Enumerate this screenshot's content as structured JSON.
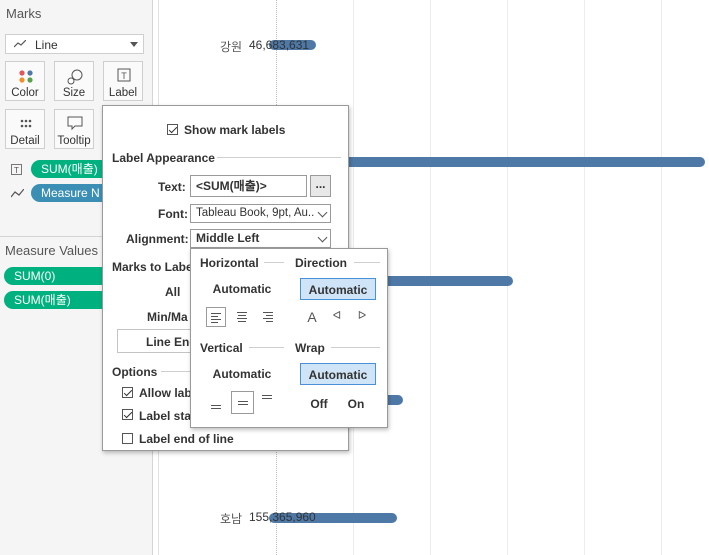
{
  "marks_pane": {
    "title": "Marks",
    "mark_type": "Line",
    "buttons": {
      "color": "Color",
      "size": "Size",
      "label": "Label",
      "detail": "Detail",
      "tooltip": "Tooltip"
    },
    "pills": {
      "label_pill": "SUM(매출)",
      "path_pill": "Measure N"
    }
  },
  "measure_values": {
    "title": "Measure Values",
    "pills": [
      "SUM(0)",
      "SUM(매출)"
    ]
  },
  "chart": {
    "rows": [
      {
        "name": "강원",
        "value_label": "46,683,631",
        "value": 46683631
      },
      {
        "name": "호남",
        "value_label": "155,365,960",
        "value": 155365960
      }
    ],
    "colors": {
      "bar": "#4e79a7",
      "pill_green": "#00b180",
      "pill_blue": "#3b8fb5",
      "selected_option": "#cfe5f7"
    }
  },
  "label_popup": {
    "show_mark_labels": "Show mark labels",
    "label_appearance": "Label Appearance",
    "text_label": "Text:",
    "text_value": "<SUM(매출)>",
    "text_more": "...",
    "font_label": "Font:",
    "font_value": "Tableau Book, 9pt, Au..",
    "alignment_label": "Alignment:",
    "alignment_value": "Middle Left",
    "marks_to_label": "Marks to Labe",
    "all": "All",
    "minmax": "Min/Ma",
    "line_ends": "Line End",
    "options": "Options",
    "allow_labels": "Allow lab",
    "label_start": "Label sta",
    "label_end": "Label end of line"
  },
  "alignment_popup": {
    "horizontal": "Horizontal",
    "direction": "Direction",
    "vertical": "Vertical",
    "wrap": "Wrap",
    "h_automatic": "Automatic",
    "dir_automatic": "Automatic",
    "v_automatic": "Automatic",
    "wrap_automatic": "Automatic",
    "wrap_off": "Off",
    "wrap_on": "On",
    "dir_glyphs": [
      "A",
      "ᐊ",
      "ᐅ"
    ]
  }
}
